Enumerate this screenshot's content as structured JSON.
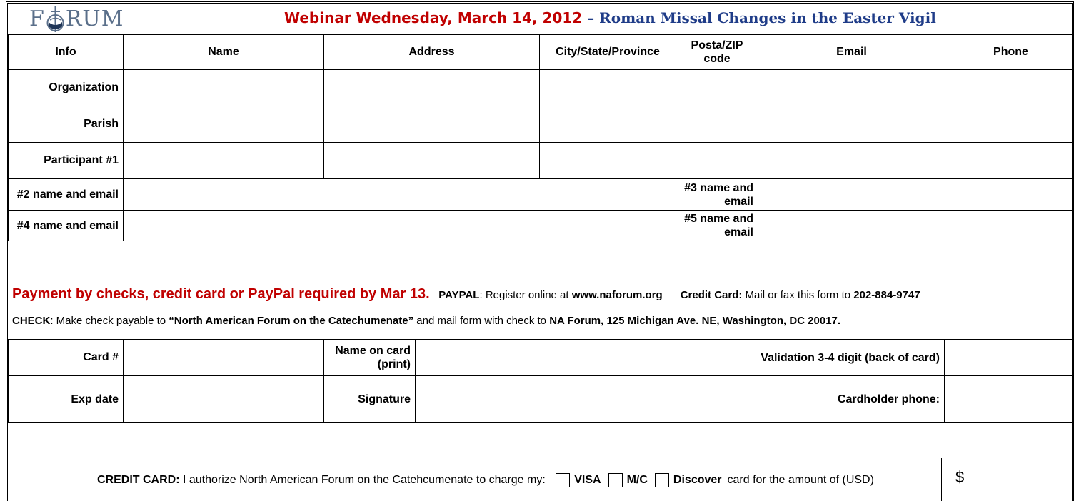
{
  "header": {
    "logo_text": "FORUM",
    "title_date": "Webinar Wednesday, March 14, 2012",
    "title_dash": " – ",
    "title_topic": "Roman Missal Changes in the Easter Vigil"
  },
  "registration": {
    "columns": [
      "Info",
      "Name",
      "Address",
      "City/State/Province",
      "Posta/ZIP code",
      "Email",
      "Phone"
    ],
    "rows": [
      "Organization",
      "Parish",
      "Participant #1"
    ],
    "extra_participants": [
      "#2  name and email",
      "#3 name and email",
      "#4 name and email",
      "#5 name and email"
    ]
  },
  "payment": {
    "headline": "Payment by checks, credit card or PayPal required by Mar 13.",
    "paypal_label": "PAYPAL",
    "paypal_text": ":  Register online at ",
    "paypal_url": "www.naforum.org",
    "cc_label": "Credit Card:",
    "cc_text": " Mail or fax this form to ",
    "cc_fax": "202-884-9747",
    "check_label": "CHECK",
    "check_text1": ":  Make check payable to ",
    "check_payee": "“North American Forum on the Catechumenate”",
    "check_text2": " and mail form with check to ",
    "check_address": "NA Forum, 125 Michigan Ave. NE, Washington, DC 20017."
  },
  "card": {
    "card_no": "Card #",
    "name_on_card": "Name on card (print)",
    "validation": "Validation 3-4 digit (back of card)",
    "exp_date": "Exp date",
    "signature": "Signature",
    "cardholder_phone": "Cardholder phone:"
  },
  "authorization": {
    "label": "CREDIT CARD:",
    "text": " I authorize North American Forum on the Catehcumenate to charge my: ",
    "visa": "VISA",
    "mc": "M/C",
    "discover": "Discover",
    "amount_text": "card for the amount of (USD)",
    "currency": "$"
  }
}
